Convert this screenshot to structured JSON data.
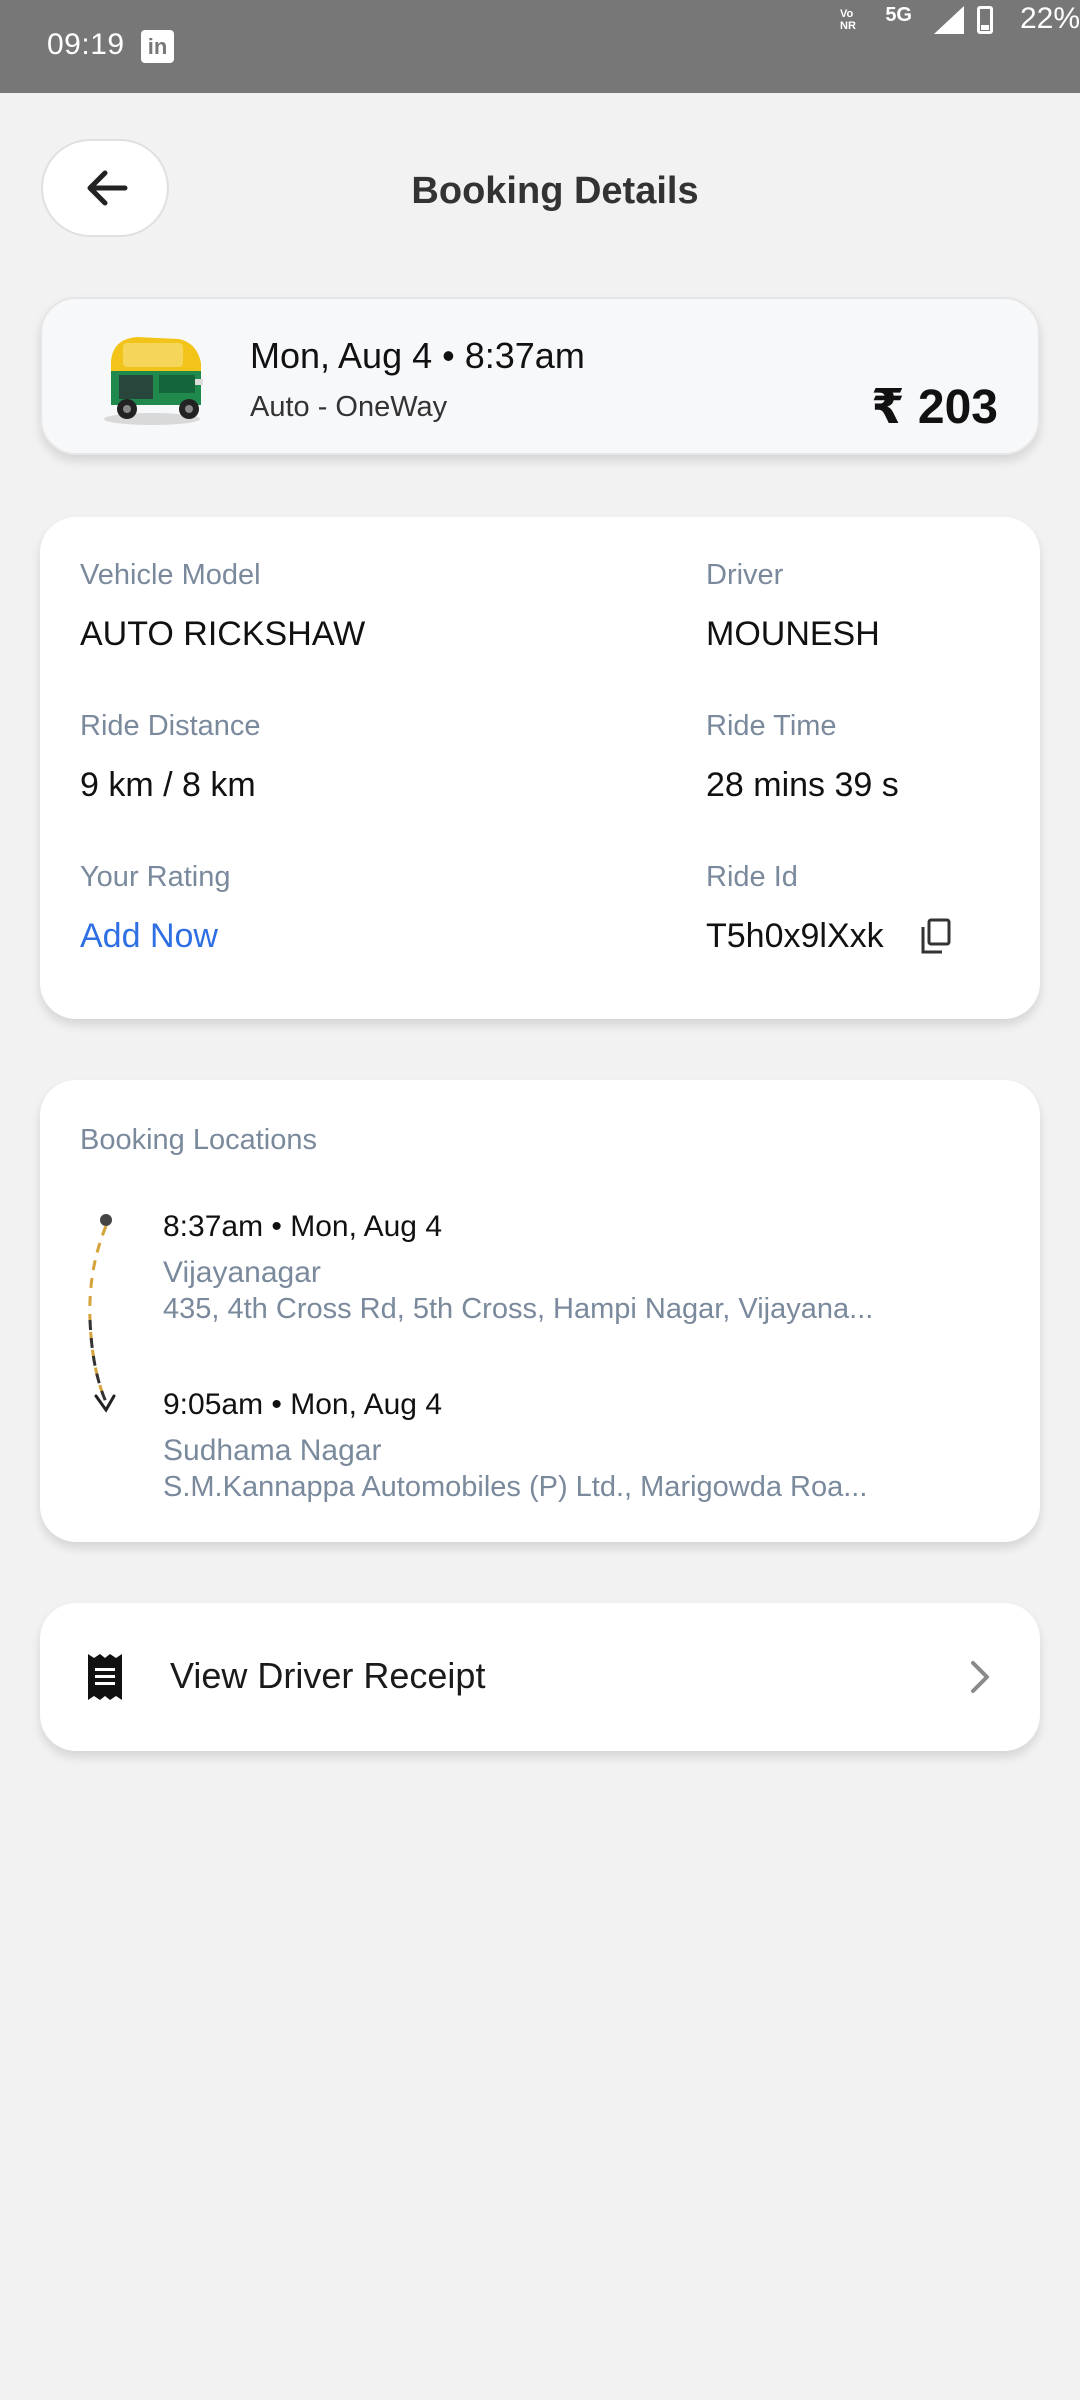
{
  "status_bar": {
    "time": "09:19",
    "app_icon": "linkedin-icon",
    "volte_label": "Vo NR",
    "network": "5G",
    "battery": "22%"
  },
  "header": {
    "back_icon": "arrow-left-icon",
    "title": "Booking Details"
  },
  "summary": {
    "vehicle_icon": "auto-rickshaw-icon",
    "datetime": "Mon, Aug 4 • 8:37am",
    "ride_type": "Auto - OneWay",
    "fare": "₹ 203"
  },
  "details": {
    "vehicle_model_label": "Vehicle Model",
    "vehicle_model": "AUTO RICKSHAW",
    "driver_label": "Driver",
    "driver": "MOUNESH",
    "ride_distance_label": "Ride Distance",
    "ride_distance": "9 km / 8 km",
    "ride_time_label": "Ride Time",
    "ride_time": "28 mins 39 s",
    "rating_label": "Your Rating",
    "rating_action": "Add Now",
    "ride_id_label": "Ride Id",
    "ride_id": "T5h0x9lXxk",
    "copy_icon": "copy-icon"
  },
  "locations": {
    "title": "Booking Locations",
    "pickup": {
      "time": "8:37am • Mon, Aug 4",
      "name": "Vijayanagar",
      "address": "435, 4th Cross Rd, 5th Cross, Hampi Nagar, Vijayana..."
    },
    "drop": {
      "time": "9:05am • Mon, Aug 4",
      "name": "Sudhama Nagar",
      "address": "S.M.Kannappa Automobiles (P) Ltd., Marigowda Roa..."
    }
  },
  "receipt": {
    "icon": "receipt-icon",
    "label": "View Driver Receipt",
    "chevron": "chevron-right-icon"
  },
  "colors": {
    "background": "#f2f2f2",
    "status_bar": "#777777",
    "link": "#2f6fe4",
    "muted_label": "#7a8a9c"
  }
}
